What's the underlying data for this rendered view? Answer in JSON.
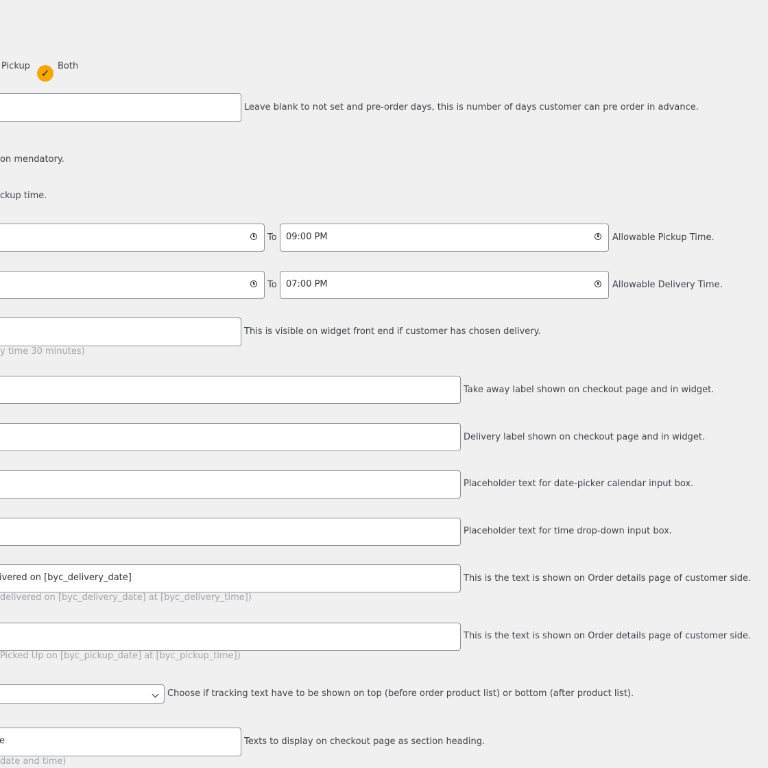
{
  "order_type": {
    "option_pickup": "Pickup",
    "option_both": "Both",
    "selected": "Both"
  },
  "preorder": {
    "value": "",
    "description": "Leave blank to not set and pre-order days, this is number of days customer can pre order in advance."
  },
  "mandatory_note": "on mendatory.",
  "pickup_time_note": "ckup time.",
  "pickup_time": {
    "from_value": "",
    "to_label": "To",
    "to_value": "09:00 PM",
    "description": "Allowable Pickup Time."
  },
  "delivery_time": {
    "from_value": "",
    "to_label": "To",
    "to_value": "07:00 PM",
    "description": "Allowable Delivery Time."
  },
  "delivery_widget": {
    "value": "",
    "description": "This is visible on widget front end if customer has chosen delivery.",
    "hint": "y time 30 minutes)"
  },
  "takeaway_label": {
    "value": "",
    "description": "Take away label shown on checkout page and in widget."
  },
  "delivery_label": {
    "value": "",
    "description": "Delivery label shown on checkout page and in widget."
  },
  "date_placeholder": {
    "value": "",
    "description": "Placeholder text for date-picker calendar input box."
  },
  "time_placeholder": {
    "value": "",
    "description": "Placeholder text for time drop-down input box."
  },
  "delivery_order_text": {
    "value": "ivered on [byc_delivery_date]",
    "description": "This is the text is shown on Order details page of customer side.",
    "hint": "delivered on [byc_delivery_date] at [byc_delivery_time])"
  },
  "pickup_order_text": {
    "value": "",
    "description": "This is the text is shown on Order details page of customer side.",
    "hint": "Picked Up on [byc_pickup_date] at [byc_pickup_time])"
  },
  "tracking_position": {
    "value": "",
    "description": "Choose if tracking text have to be shown on top (before order product list) or bottom (after product list)."
  },
  "checkout_heading": {
    "value": "e",
    "description": "Texts to display on checkout page as section heading.",
    "hint": "date and time)"
  },
  "colors": {
    "background": "#f0f0f1",
    "accent_check": "#f7a701",
    "input_border": "#8c8f94",
    "hint_text": "#a0a5aa"
  }
}
